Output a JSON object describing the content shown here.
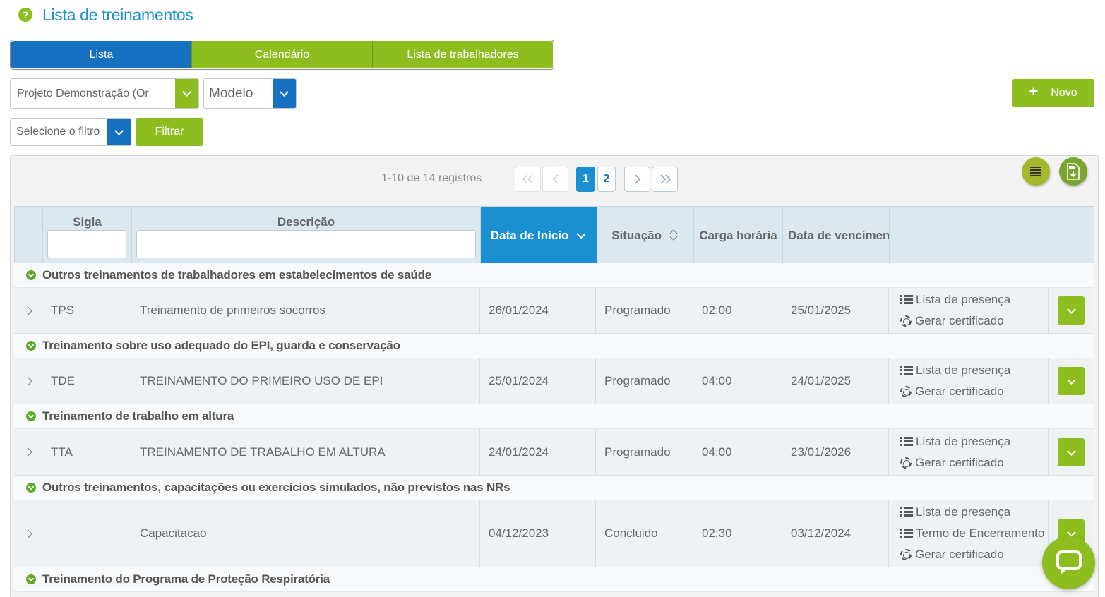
{
  "page": {
    "title": "Lista de treinamentos"
  },
  "tabs": [
    {
      "label": "Lista",
      "active": true
    },
    {
      "label": "Calendário",
      "active": false
    },
    {
      "label": "Lista de trabalhadores",
      "active": false
    }
  ],
  "filters": {
    "projeto": "Projeto Demonstração (Or",
    "modelo": "Modelo",
    "filtro_placeholder": "Selecione o filtro",
    "filtrar_label": "Filtrar"
  },
  "toolbar": {
    "novo_label": "Novo"
  },
  "pager": {
    "info": "1-10 de 14 registros",
    "pages": [
      "1",
      "2"
    ],
    "current": "1"
  },
  "table": {
    "columns": {
      "sigla": "Sigla",
      "descricao": "Descrição",
      "data_inicio": "Data de Início",
      "situacao": "Situação",
      "carga": "Carga horária",
      "vencimento": "Data de vencimento"
    },
    "groups": [
      {
        "name": "Outros treinamentos de trabalhadores em estabelecimentos de saúde",
        "rows": [
          {
            "sigla": "TPS",
            "descricao": "Treinamento de primeiros socorros",
            "inicio": "26/01/2024",
            "situacao": "Programado",
            "carga": "02:00",
            "vencimento": "25/01/2025",
            "actions": [
              "Lista de presença",
              "Gerar certificado"
            ]
          }
        ]
      },
      {
        "name": "Treinamento sobre uso adequado do EPI, guarda e conservação",
        "rows": [
          {
            "sigla": "TDE",
            "descricao": "TREINAMENTO DO PRIMEIRO USO DE EPI",
            "inicio": "25/01/2024",
            "situacao": "Programado",
            "carga": "04:00",
            "vencimento": "24/01/2025",
            "actions": [
              "Lista de presença",
              "Gerar certificado"
            ]
          }
        ]
      },
      {
        "name": "Treinamento de trabalho em altura",
        "rows": [
          {
            "sigla": "TTA",
            "descricao": "TREINAMENTO DE TRABALHO EM ALTURA",
            "inicio": "24/01/2024",
            "situacao": "Programado",
            "carga": "04:00",
            "vencimento": "23/01/2026",
            "actions": [
              "Lista de presença",
              "Gerar certificado"
            ]
          }
        ]
      },
      {
        "name": "Outros treinamentos, capacitações ou exercícios simulados, não previstos nas NRs",
        "rows": [
          {
            "sigla": "",
            "descricao": "Capacitacao",
            "inicio": "04/12/2023",
            "situacao": "Concluido",
            "carga": "02:30",
            "vencimento": "03/12/2024",
            "actions": [
              "Lista de presença",
              "Termo de Encerramento",
              "Gerar certificado"
            ]
          }
        ]
      },
      {
        "name": "Treinamento do Programa de Proteção Respiratória",
        "rows": []
      }
    ]
  },
  "colors": {
    "accent_blue": "#1a90d0",
    "tab_blue": "#1570c0",
    "brand_green": "#8dbd1f"
  }
}
